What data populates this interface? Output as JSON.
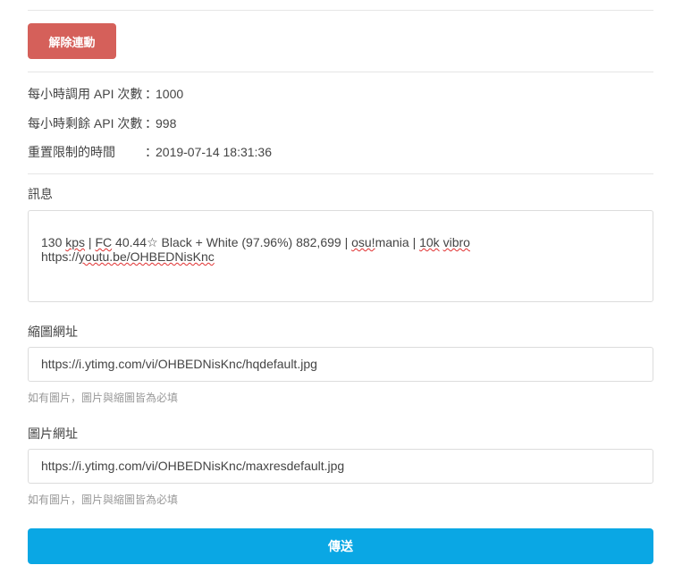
{
  "unlink_button": "解除連動",
  "api_info": [
    {
      "label": "每小時調用 API 次數",
      "value": "1000"
    },
    {
      "label": "每小時剩餘 API 次數",
      "value": "998"
    },
    {
      "label": "重置限制的時間",
      "value": "2019-07-14 18:31:36"
    }
  ],
  "colon": "：",
  "message": {
    "label": "訊息",
    "text_parts": [
      "130 ",
      "kps",
      " | ",
      "FC",
      " 40.44☆ Black + White (97.96%) 882,699 | ",
      "osu!",
      "mania | ",
      "10k",
      " ",
      "vibro"
    ],
    "line2_parts": [
      "https://",
      "youtu.be/OHBEDNisKnc"
    ]
  },
  "thumbnail": {
    "label": "縮圖網址",
    "value": "https://i.ytimg.com/vi/OHBEDNisKnc/hqdefault.jpg",
    "help": "如有圖片，圖片與縮圖皆為必填"
  },
  "image": {
    "label": "圖片網址",
    "value": "https://i.ytimg.com/vi/OHBEDNisKnc/maxresdefault.jpg",
    "help": "如有圖片，圖片與縮圖皆為必填"
  },
  "send_button": "傳送",
  "colors": {
    "unlink": "#d5605a",
    "send": "#0aa7e4"
  }
}
